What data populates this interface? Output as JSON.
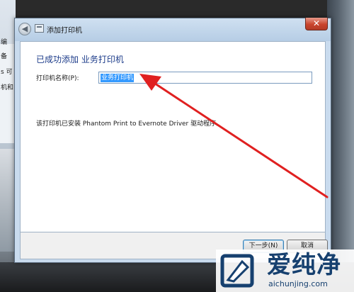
{
  "background": {
    "left_texts": [
      "编",
      "备",
      "s 可",
      "机和"
    ]
  },
  "window": {
    "title": "添加打印机",
    "back_glyph": "◀",
    "close_glyph": "✕"
  },
  "content": {
    "heading": "已成功添加 业务打印机",
    "name_label": "打印机名称(P):",
    "name_value": "业务打印机",
    "info": "该打印机已安装 Phantom Print to Evernote Driver 驱动程序。"
  },
  "footer": {
    "next_label": "下一步(N)",
    "cancel_label": "取消"
  },
  "watermark": {
    "title": "爱纯净",
    "url": "aichunjing.com"
  },
  "colors": {
    "heading": "#1d3c8a",
    "arrow": "#e02020",
    "selection": "#3399ff"
  }
}
